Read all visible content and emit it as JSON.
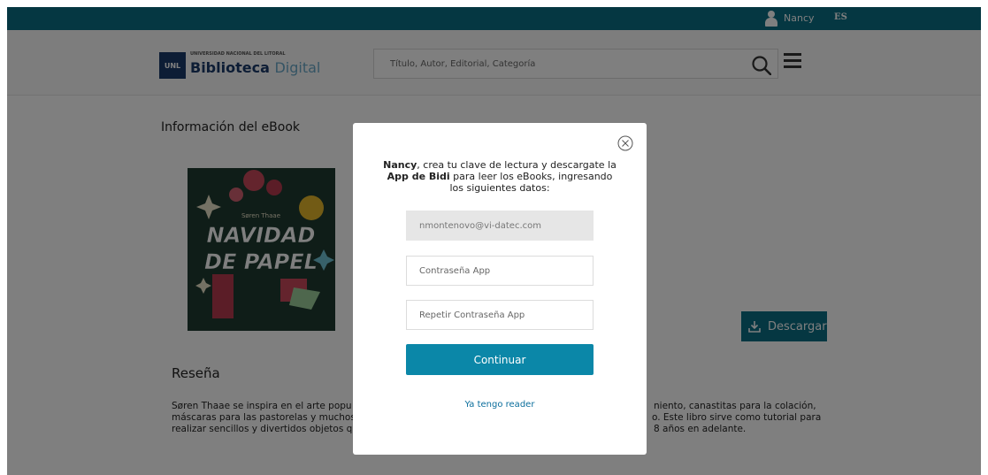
{
  "topbar": {
    "user_name": "Nancy",
    "language": "ES"
  },
  "header": {
    "logo_sub": "UNIVERSIDAD NACIONAL DEL LITORAL",
    "logo_box": "UNL",
    "logo_main_bold": "Biblioteca",
    "logo_main_light": "Digital",
    "search_placeholder": "Título, Autor, Editorial, Categoría"
  },
  "content": {
    "info_title": "Información del eBook",
    "cover_author": "Søren Thaae",
    "cover_title_1": "NAVIDAD",
    "cover_title_2": "DE PAPEL",
    "download_label": "Descargar",
    "review_title": "Reseña",
    "review_lines": [
      "Søren Thaae se inspira en el arte popu",
      "máscaras para las pastorelas y muchos",
      "realizar sencillos y divertidos objetos q"
    ],
    "review_lines_right": [
      "niento, canastitas para la colación,",
      "o. Este libro sirve como tutorial para",
      "8 años en adelante."
    ]
  },
  "modal": {
    "msg_name": "Nancy",
    "msg_part1": ", crea tu clave de lectura y descargate la ",
    "msg_app": "App de Bidi",
    "msg_part2": " para leer los eBooks, ingresando los siguientes datos:",
    "email_value": "nmontenovo@vi-datec.com",
    "password_placeholder": "Contraseña App",
    "password_repeat_placeholder": "Repetir Contraseña App",
    "continue_label": "Continuar",
    "reader_link": "Ya tengo reader"
  },
  "colors": {
    "brand": "#0b6e85",
    "button": "#0b87a8"
  }
}
